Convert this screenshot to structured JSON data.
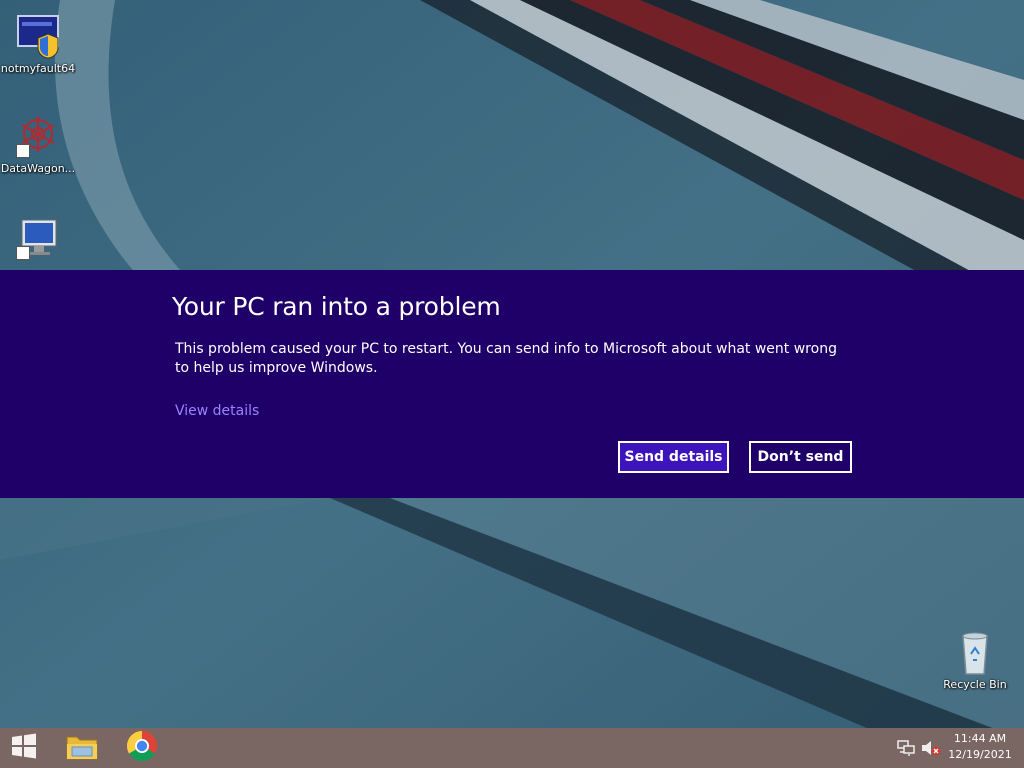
{
  "desktop": {
    "icons": [
      {
        "label": "notmyfault64",
        "icon": "application-uac-icon"
      },
      {
        "label": "DataWagon...",
        "icon": "datawagon-snowflake-icon"
      },
      {
        "label": "",
        "icon": "computer-monitor-icon"
      }
    ],
    "recycle_bin": {
      "label": "Recycle Bin",
      "icon": "recycle-bin-icon"
    }
  },
  "dialog": {
    "title": "Your PC ran into a problem",
    "description": "This problem caused your PC to restart. You can send info to Microsoft about what went wrong to help us improve Windows.",
    "view_details_link": "View details",
    "send_details_label": "Send details",
    "dont_send_label": "Don’t send",
    "colors": {
      "background": "#1f0068",
      "primary_button": "#3d14bb",
      "link": "#9b82ff"
    }
  },
  "taskbar": {
    "start_icon": "windows-logo-icon",
    "pinned": [
      {
        "name": "File Explorer",
        "icon": "folder-icon"
      },
      {
        "name": "Google Chrome",
        "icon": "chrome-icon"
      }
    ],
    "tray": {
      "network_icon": "network-icon",
      "volume_icon": "volume-muted-icon",
      "time": "11:44 AM",
      "date": "12/19/2021"
    },
    "color": "#7a6662"
  }
}
